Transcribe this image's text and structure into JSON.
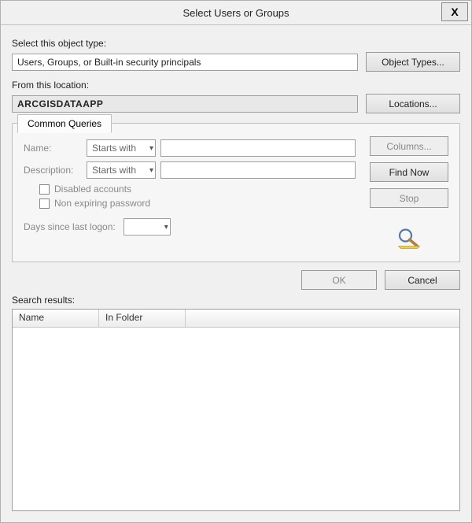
{
  "title": "Select Users or Groups",
  "close_glyph": "X",
  "labels": {
    "object_type": "Select this object type:",
    "from_location": "From this location:",
    "search_results": "Search results:"
  },
  "object_type": {
    "value": "Users, Groups, or Built-in security principals",
    "button": "Object Types..."
  },
  "location": {
    "value": "ARCGISDATAAPP",
    "button": "Locations..."
  },
  "queries": {
    "tab": "Common Queries",
    "name_label": "Name:",
    "name_op": "Starts with",
    "description_label": "Description:",
    "description_op": "Starts with",
    "disabled_accounts": "Disabled accounts",
    "non_expiring": "Non expiring password",
    "days_since": "Days since last logon:",
    "days_value": ""
  },
  "side": {
    "columns": "Columns...",
    "find_now": "Find Now",
    "stop": "Stop"
  },
  "buttons": {
    "ok": "OK",
    "cancel": "Cancel"
  },
  "results": {
    "columns": [
      "Name",
      "In Folder"
    ]
  }
}
